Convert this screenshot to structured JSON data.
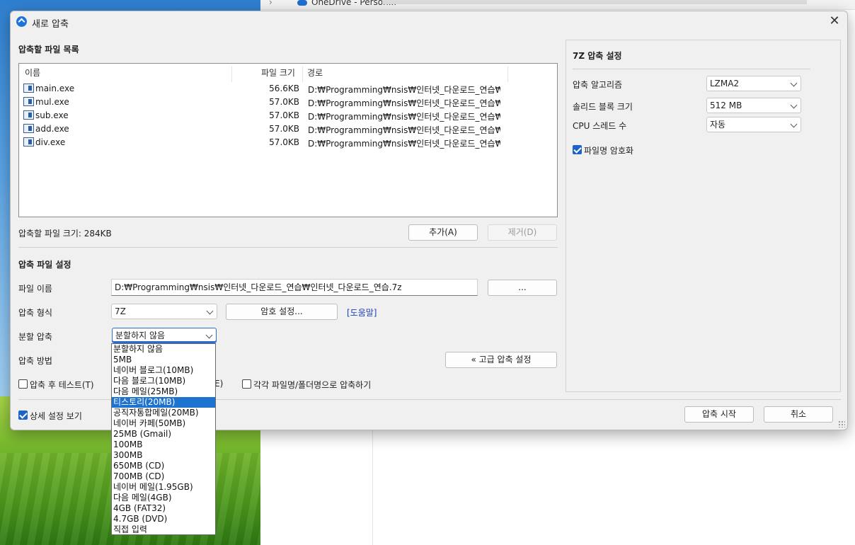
{
  "background": {
    "onedrive_label": "OneDrive - Person..."
  },
  "dialog": {
    "title": "새로 압축",
    "close_glyph": "✕"
  },
  "file_list": {
    "heading": "압축할 파일 목록",
    "columns": [
      "이름",
      "파일 크기",
      "경로"
    ],
    "rows": [
      {
        "name": "main.exe",
        "size": "56.6KB",
        "path": "D:₩Programming₩nsis₩인터넷_다운로드_연습₩..."
      },
      {
        "name": "mul.exe",
        "size": "57.0KB",
        "path": "D:₩Programming₩nsis₩인터넷_다운로드_연습₩..."
      },
      {
        "name": "sub.exe",
        "size": "57.0KB",
        "path": "D:₩Programming₩nsis₩인터넷_다운로드_연습₩s..."
      },
      {
        "name": "add.exe",
        "size": "57.0KB",
        "path": "D:₩Programming₩nsis₩인터넷_다운로드_연습₩a..."
      },
      {
        "name": "div.exe",
        "size": "57.0KB",
        "path": "D:₩Programming₩nsis₩인터넷_다운로드_연습₩d..."
      }
    ],
    "total_size": "압축할 파일 크기: 284KB",
    "add_label": "추가(A)",
    "remove_label": "제거(D)"
  },
  "settings": {
    "heading": "압축 파일 설정",
    "filename_label": "파일 이름",
    "filename_value": "D:₩Programming₩nsis₩인터넷_다운로드_연습₩인터넷_다운로드_연습.7z",
    "browse_label": "...",
    "format_label": "압축 형식",
    "format_value": "7Z",
    "password_label": "암호 설정...",
    "help_label": "[도움말]",
    "split_label": "분할 압축",
    "split_value": "분할하지 않음",
    "method_label": "압축 방법",
    "advanced_label": "« 고급 압축 설정",
    "test_label": "압축 후 테스트(T)",
    "hidden_fragment": "E)",
    "each_label": "각각 파일명/폴더명으로 압축하기",
    "detail_label": "상세 설정 보기",
    "start_label": "압축 시작",
    "cancel_label": "취소"
  },
  "seven_z": {
    "heading": "7Z 압축 설정",
    "algo_label": "압축 알고리즘",
    "algo_value": "LZMA2",
    "solid_label": "솔리드 블록 크기",
    "solid_value": "512 MB",
    "cpu_label": "CPU 스레드 수",
    "cpu_value": "자동",
    "encrypt_label": "파일명 암호화"
  },
  "split_options": [
    "분할하지 않음",
    "5MB",
    "네이버 블로그(10MB)",
    "다음 블로그(10MB)",
    "다음 메일(25MB)",
    "티스토리(20MB)",
    "공직자통합메일(20MB)",
    "네이버 카페(50MB)",
    "25MB (Gmail)",
    "100MB",
    "300MB",
    "650MB (CD)",
    "700MB (CD)",
    "네이버 메일(1.95GB)",
    "다음 메일(4GB)",
    "4GB (FAT32)",
    "4.7GB (DVD)",
    "직접 입력"
  ],
  "split_selected": "티스토리(20MB)",
  "checks": {
    "test": false,
    "each": false,
    "detail": true,
    "encrypt_names": true
  }
}
